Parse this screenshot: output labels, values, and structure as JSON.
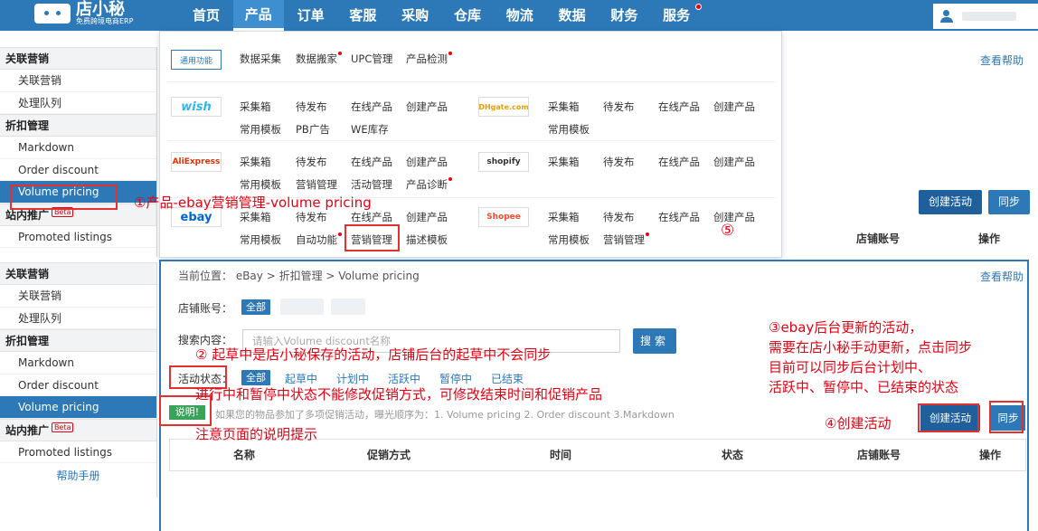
{
  "topnav": {
    "logo_name": "店小秘",
    "logo_sub": "免费跨境电商ERP",
    "items": [
      "首页",
      "产品",
      "订单",
      "客服",
      "采购",
      "仓库",
      "物流",
      "数据",
      "财务",
      "服务"
    ]
  },
  "sidebar_top": {
    "sections": [
      {
        "title": "关联营销",
        "items": [
          "关联营销",
          "处理队列"
        ]
      },
      {
        "title": "折扣管理",
        "items": [
          "Markdown",
          "Order discount",
          "Volume pricing"
        ]
      },
      {
        "title": "站内推广",
        "badge": "Beta",
        "items": [
          "Promoted listings"
        ]
      }
    ]
  },
  "sidebar_bottom": {
    "sections": [
      {
        "title": "关联营销",
        "items": [
          "关联营销",
          "处理队列"
        ]
      },
      {
        "title": "折扣管理",
        "items": [
          "Markdown",
          "Order discount",
          "Volume pricing"
        ]
      },
      {
        "title": "站内推广",
        "badge": "Beta",
        "items": [
          "Promoted listings"
        ]
      }
    ],
    "help_manual": "帮助手册"
  },
  "background_page": {
    "help_link": "查看帮助",
    "create_button": "创建活动",
    "sync_button": "同步",
    "col_store": "店铺账号",
    "col_action": "操作"
  },
  "megamenu": {
    "general": {
      "logo": "通用功能",
      "links": [
        "数据采集",
        "数据搬家",
        "UPC管理",
        "产品检测"
      ]
    },
    "wish": {
      "logo": "wish",
      "row1": [
        "采集箱",
        "待发布",
        "在线产品",
        "创建产品"
      ],
      "row2": [
        "常用模板",
        "PB广告",
        "WE库存"
      ]
    },
    "dhgate": {
      "logo": "DHgate.com",
      "row1": [
        "采集箱",
        "待发布",
        "在线产品",
        "创建产品"
      ],
      "row2": [
        "常用模板"
      ]
    },
    "aliexpress": {
      "logo": "AliExpress",
      "row1": [
        "采集箱",
        "待发布",
        "在线产品",
        "创建产品"
      ],
      "row2": [
        "常用模板",
        "营销管理",
        "活动管理",
        "产品诊断"
      ]
    },
    "shopify": {
      "logo": "shopify",
      "row1": [
        "采集箱",
        "待发布",
        "在线产品",
        "创建产品"
      ]
    },
    "ebay": {
      "logo": "ebay",
      "row1": [
        "采集箱",
        "待发布",
        "在线产品",
        "创建产品"
      ],
      "row2": [
        "常用模板",
        "自动功能",
        "营销管理",
        "描述模板"
      ]
    },
    "shopee": {
      "logo": "Shopee",
      "row1": [
        "采集箱",
        "待发布",
        "在线产品",
        "创建产品"
      ],
      "row2": [
        "常用模板",
        "营销管理"
      ]
    }
  },
  "foreground_page": {
    "breadcrumb": "当前位置：  eBay > 折扣管理 > Volume pricing",
    "help_link": "查看帮助",
    "store_label": "店铺账号：",
    "all_tag": "全部",
    "search_label": "搜索内容：",
    "search_placeholder": "请输入Volume discount名称",
    "search_button": "搜索",
    "status_label": "活动状态：",
    "status_all": "全部",
    "statuses": [
      "起草中",
      "计划中",
      "活跃中",
      "暂停中",
      "已结束"
    ],
    "note_tag": "说明!",
    "note_text": "如果您的物品参加了多项促销活动，曝光顺序为：1. Volume pricing 2. Order discount 3.Markdown",
    "create_button": "创建活动",
    "sync_button": "同步",
    "columns": [
      "名称",
      "促销方式",
      "时间",
      "状态",
      "店铺账号",
      "操作"
    ]
  },
  "annotations": {
    "a1": "①产品-ebay营销管理-volume pricing",
    "a5": "⑤",
    "a2_line1": "② 起草中是店小秘保存的活动，店铺后台的起草中不会同步",
    "a2_line2": "进行中和暂停中状态不能修改促销方式，可修改结束时间和促销产品",
    "a_note": "注意页面的说明提示",
    "a3_line1": "③ebay后台更新的活动，",
    "a3_line2": "需要在店小秘手动更新，点击同步",
    "a3_line3": "目前可以同步后台计划中、",
    "a3_line4": "活跃中、暂停中、已结束的状态",
    "a4": "④创建活动"
  },
  "colors": {
    "primary": "#2d78b6",
    "dark_button": "#1f5f9b",
    "annotation": "#e60012",
    "note_green": "#3aa35b"
  }
}
